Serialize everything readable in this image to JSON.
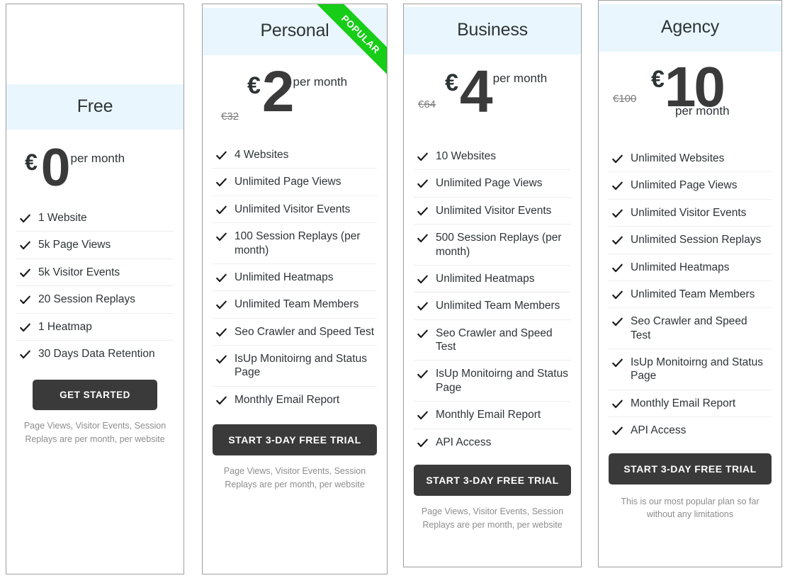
{
  "currency_symbol": "€",
  "colors": {
    "header_band": "#e9f6fd",
    "ribbon_green": "#17cd17",
    "button_dark": "#3a3a3a",
    "text_dark": "#2d3436",
    "note_gray": "#8d8d8d"
  },
  "plans": [
    {
      "id": "free",
      "name": "Free",
      "price": "0",
      "old_price": "",
      "per_month": "per month",
      "cta": "GET STARTED",
      "badge": "",
      "note": "Page Views, Visitor Events, Session Replays are per month, per website",
      "features": [
        "1 Website",
        "5k Page Views",
        "5k Visitor Events",
        "20 Session Replays",
        "1 Heatmap",
        "30 Days Data Retention"
      ]
    },
    {
      "id": "personal",
      "name": "Personal",
      "price": "2",
      "old_price": "€32",
      "per_month": "per month",
      "cta": "START 3-DAY FREE TRIAL",
      "badge": "POPULAR",
      "note": "Page Views, Visitor Events, Session Replays are per month, per website",
      "features": [
        "4 Websites",
        "Unlimited Page Views",
        "Unlimited Visitor Events",
        "100 Session Replays (per month)",
        "Unlimited Heatmaps",
        "Unlimited Team Members",
        "Seo Crawler and Speed Test",
        "IsUp Monitoirng and Status Page",
        "Monthly Email Report"
      ]
    },
    {
      "id": "business",
      "name": "Business",
      "price": "4",
      "old_price": "€64",
      "per_month": "per month",
      "cta": "START 3-DAY FREE TRIAL",
      "badge": "",
      "note": "Page Views, Visitor Events, Session Replays are per month, per website",
      "features": [
        "10 Websites",
        "Unlimited Page Views",
        "Unlimited Visitor Events",
        "500 Session Replays (per month)",
        "Unlimited Heatmaps",
        "Unlimited Team Members",
        "Seo Crawler and Speed Test",
        "IsUp Monitoirng and Status Page",
        "Monthly Email Report",
        "API Access"
      ]
    },
    {
      "id": "agency",
      "name": "Agency",
      "price": "10",
      "old_price": "€100",
      "per_month": "per month",
      "cta": "START 3-DAY FREE TRIAL",
      "badge": "",
      "note": "This is our most popular plan so far without any limitations",
      "features": [
        "Unlimited Websites",
        "Unlimited Page Views",
        "Unlimited Visitor Events",
        "Unlimited Session Replays",
        "Unlimited Heatmaps",
        "Unlimited Team Members",
        "Seo Crawler and Speed Test",
        "IsUp Monitoirng and Status Page",
        "Monthly Email Report",
        "API Access"
      ]
    }
  ]
}
